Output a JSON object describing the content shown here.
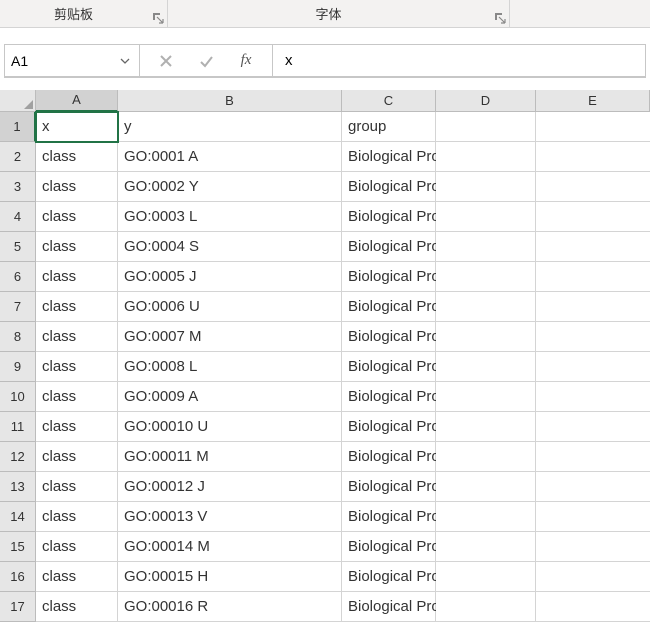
{
  "ribbon": {
    "clipboard_label": "剪贴板",
    "font_label": "字体"
  },
  "formula_bar": {
    "name_box_value": "A1",
    "fx_label": "fx",
    "formula_value": "x"
  },
  "columns": [
    "A",
    "B",
    "C",
    "D",
    "E"
  ],
  "selected_cell": {
    "row": 1,
    "col": "A"
  },
  "rows": [
    {
      "n": 1,
      "A": "x",
      "B": "y",
      "C": "group",
      "D": ""
    },
    {
      "n": 2,
      "A": "class",
      "B": "GO:0001 A",
      "C_D": "Biological Process"
    },
    {
      "n": 3,
      "A": "class",
      "B": "GO:0002 Y",
      "C_D": "Biological Process"
    },
    {
      "n": 4,
      "A": "class",
      "B": "GO:0003 L",
      "C_D": "Biological Process"
    },
    {
      "n": 5,
      "A": "class",
      "B": "GO:0004 S",
      "C_D": "Biological Process"
    },
    {
      "n": 6,
      "A": "class",
      "B": "GO:0005 J",
      "C_D": "Biological Process"
    },
    {
      "n": 7,
      "A": "class",
      "B": "GO:0006 U",
      "C_D": "Biological Process"
    },
    {
      "n": 8,
      "A": "class",
      "B": "GO:0007 M",
      "C_D": "Biological Process"
    },
    {
      "n": 9,
      "A": "class",
      "B": "GO:0008 L",
      "C_D": "Biological Process"
    },
    {
      "n": 10,
      "A": "class",
      "B": "GO:0009 A",
      "C_D": "Biological Process"
    },
    {
      "n": 11,
      "A": "class",
      "B": "GO:00010 U",
      "C_D": "Biological Process"
    },
    {
      "n": 12,
      "A": "class",
      "B": "GO:00011 M",
      "C_D": "Biological Process"
    },
    {
      "n": 13,
      "A": "class",
      "B": "GO:00012 J",
      "C_D": "Biological Process"
    },
    {
      "n": 14,
      "A": "class",
      "B": "GO:00013 V",
      "C_D": "Biological Process"
    },
    {
      "n": 15,
      "A": "class",
      "B": "GO:00014 M",
      "C_D": "Biological Process"
    },
    {
      "n": 16,
      "A": "class",
      "B": "GO:00015 H",
      "C_D": "Biological Process"
    },
    {
      "n": 17,
      "A": "class",
      "B": "GO:00016 R",
      "C_D": "Biological Process"
    }
  ]
}
